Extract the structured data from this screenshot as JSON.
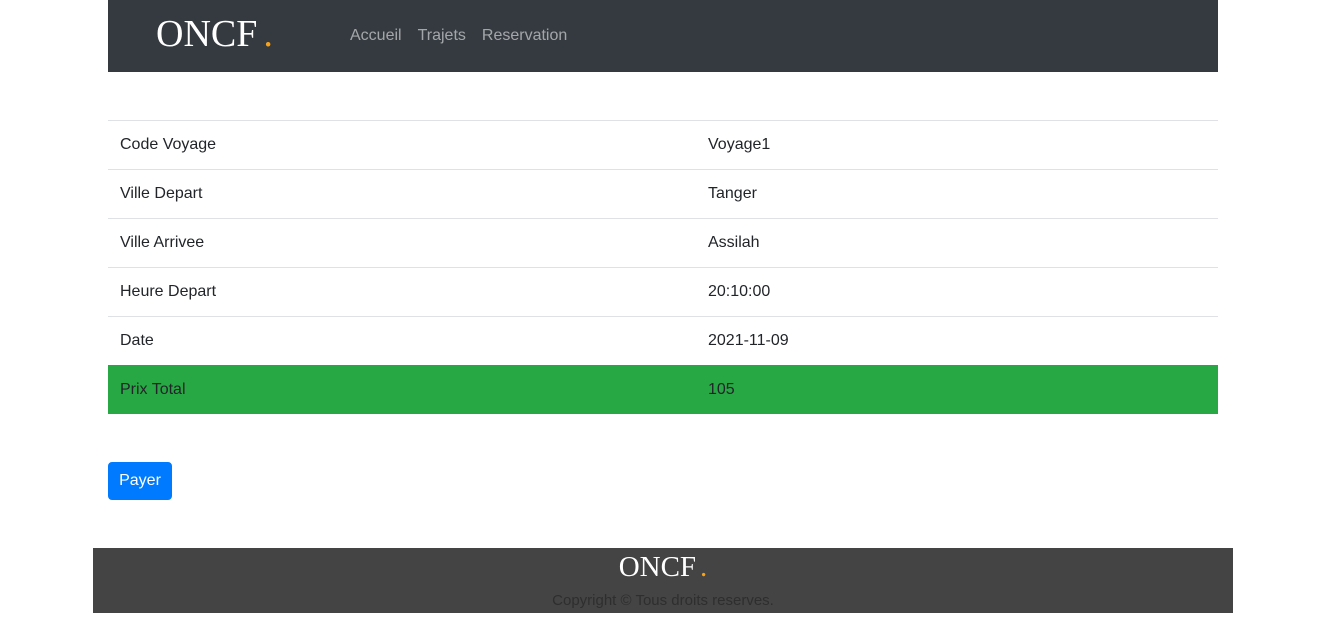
{
  "navbar": {
    "brand": "ONCF",
    "brand_dot": ".",
    "links": [
      {
        "label": "Accueil"
      },
      {
        "label": "Trajets"
      },
      {
        "label": "Reservation"
      }
    ]
  },
  "details": {
    "rows": [
      {
        "label": "Code Voyage",
        "value": "Voyage1"
      },
      {
        "label": "Ville Depart",
        "value": "Tanger"
      },
      {
        "label": "Ville Arrivee",
        "value": "Assilah"
      },
      {
        "label": "Heure Depart",
        "value": "20:10:00"
      },
      {
        "label": "Date",
        "value": "2021-11-09"
      },
      {
        "label": "Prix Total",
        "value": "105"
      }
    ]
  },
  "actions": {
    "pay_label": "Payer"
  },
  "footer": {
    "brand": "ONCF",
    "brand_dot": ".",
    "copyright": "Copyright © Tous droits reserves."
  },
  "colors": {
    "navbar_bg": "#343a40",
    "accent_dot": "#f7a21b",
    "total_row": "#28a745",
    "primary_button": "#007bff",
    "footer_bg": "#444444"
  }
}
